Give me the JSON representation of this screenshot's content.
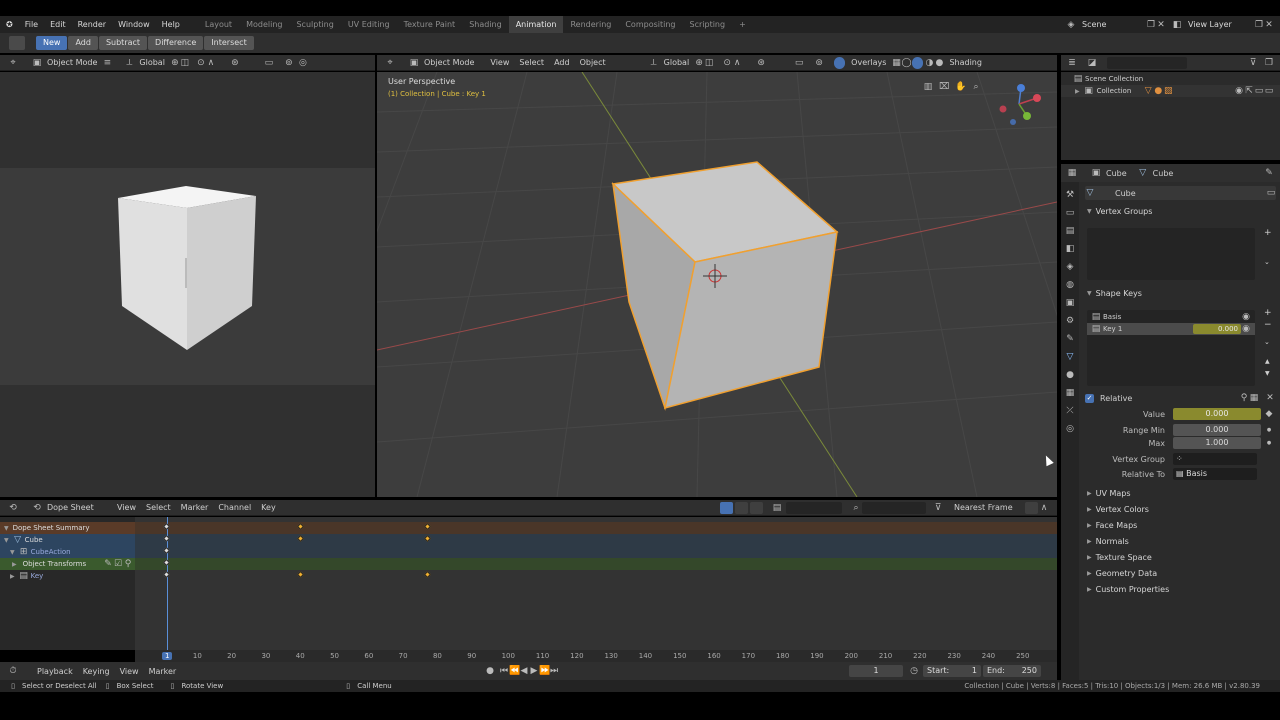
{
  "topbar": {
    "menus": [
      "File",
      "Edit",
      "Render",
      "Window",
      "Help"
    ],
    "workspaces": [
      "Layout",
      "Modeling",
      "Sculpting",
      "UV Editing",
      "Texture Paint",
      "Shading",
      "Animation",
      "Rendering",
      "Compositing",
      "Scripting"
    ],
    "active_workspace": "Animation",
    "scene": "Scene",
    "view_layer": "View Layer"
  },
  "toolhdr": {
    "buttons": [
      "New",
      "Add",
      "Subtract",
      "Difference",
      "Intersect"
    ]
  },
  "left_header": {
    "mode": "Object Mode",
    "orientation": "Global"
  },
  "main_header": {
    "mode": "Object Mode",
    "menus": [
      "View",
      "Select",
      "Add",
      "Object"
    ],
    "orientation": "Global",
    "overlays": "Overlays",
    "shading": "Shading"
  },
  "viewport": {
    "perspective": "User Perspective",
    "collection_info": "(1) Collection | Cube : Key 1"
  },
  "outliner": {
    "scene_collection": "Scene Collection",
    "collection": "Collection"
  },
  "properties": {
    "object_name": "Cube",
    "mesh_name": "Cube",
    "data_name": "Cube",
    "vertex_groups": "Vertex Groups",
    "shape_keys": "Shape Keys",
    "keys": [
      {
        "name": "Basis",
        "value": ""
      },
      {
        "name": "Key 1",
        "value": "0.000"
      }
    ],
    "relative": "Relative",
    "value_label": "Value",
    "value": "0.000",
    "range_min_label": "Range Min",
    "range_min": "0.000",
    "max_label": "Max",
    "max": "1.000",
    "vertex_group_label": "Vertex Group",
    "relative_to_label": "Relative To",
    "relative_to": "Basis",
    "collapsed_panels": [
      "UV Maps",
      "Vertex Colors",
      "Face Maps",
      "Normals",
      "Texture Space",
      "Geometry Data",
      "Custom Properties"
    ]
  },
  "dopesheet": {
    "editor": "Dope Sheet",
    "menus": [
      "View",
      "Select",
      "Marker",
      "Channel",
      "Key"
    ],
    "snap": "Nearest Frame",
    "channels": [
      "Dope Sheet Summary",
      "Cube",
      "CubeAction",
      "Object Transforms",
      "Key"
    ],
    "scale_ticks": [
      "1",
      "10",
      "20",
      "30",
      "40",
      "50",
      "60",
      "70",
      "80",
      "90",
      "100",
      "110",
      "120",
      "130",
      "140",
      "150",
      "160",
      "170",
      "180",
      "190",
      "200",
      "210",
      "220",
      "230",
      "240",
      "250"
    ],
    "keyframes": [
      1,
      40,
      77
    ]
  },
  "timeline": {
    "menus": [
      "Playback",
      "Keying",
      "View",
      "Marker"
    ],
    "current_frame": "1",
    "start_label": "Start:",
    "start": "1",
    "end_label": "End:",
    "end": "250"
  },
  "status": {
    "select": "Select or Deselect All",
    "box": "Box Select",
    "rotate": "Rotate View",
    "call_menu": "Call Menu",
    "info": "Collection | Cube | Verts:8 | Faces:5 | Tris:10 | Objects:1/3 | Mem: 26.6 MB | v2.80.39"
  },
  "colors": {
    "accent": "#4772b3",
    "selection": "#f0a030",
    "keyframe": "#f0b030"
  }
}
